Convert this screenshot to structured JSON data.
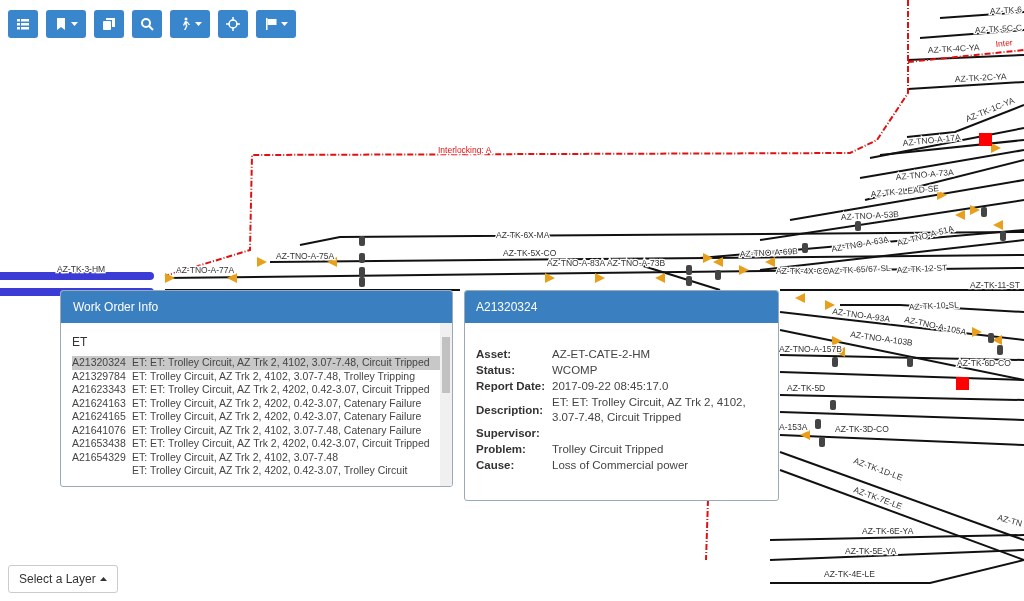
{
  "toolbar": {
    "buttons": [
      {
        "dropdown": false
      },
      {
        "dropdown": true
      },
      {
        "dropdown": false
      },
      {
        "dropdown": false
      },
      {
        "dropdown": true
      },
      {
        "dropdown": false
      },
      {
        "dropdown": true
      }
    ]
  },
  "map": {
    "labels": [
      {
        "text": "AZ-TK-6",
        "kind": "track"
      },
      {
        "text": "AZ-TK-5C-C",
        "kind": "track"
      },
      {
        "text": "Inter",
        "kind": "zone"
      },
      {
        "text": "AZ-TK-4C-YA",
        "kind": "track"
      },
      {
        "text": "AZ-TK-2C-YA",
        "kind": "track"
      },
      {
        "text": "AZ-TK-1C-YA",
        "kind": "track"
      },
      {
        "text": "Interlocking: A",
        "kind": "zone"
      },
      {
        "text": "AZ-TNO-A-17A",
        "kind": "track"
      },
      {
        "text": "AZ-TNO-A-73A",
        "kind": "track"
      },
      {
        "text": "AZ-TK-2LEAD-SE",
        "kind": "track"
      },
      {
        "text": "AZ-TNO-A-53B",
        "kind": "track"
      },
      {
        "text": "AZ-TK-6X-MA",
        "kind": "track"
      },
      {
        "text": "AZ-TNO-A-51A",
        "kind": "track"
      },
      {
        "text": "AZ-TNO-A-75A",
        "kind": "track"
      },
      {
        "text": "AZ-TK-5X-CO",
        "kind": "track"
      },
      {
        "text": "AZ-TNO-A-69B",
        "kind": "track"
      },
      {
        "text": "AZ-TNO-A-63A",
        "kind": "track"
      },
      {
        "text": "AZ-TK-3-HM",
        "kind": "track"
      },
      {
        "text": "AZ-TNO-A-77A",
        "kind": "track"
      },
      {
        "text": "AZ-TNO-A-83A",
        "kind": "track"
      },
      {
        "text": "AZ-TNO-A-73B",
        "kind": "track"
      },
      {
        "text": "AZ-TK-4X-CO",
        "kind": "track"
      },
      {
        "text": "AZ-TK-65/67-SL",
        "kind": "track"
      },
      {
        "text": "AZ-TK-12-ST",
        "kind": "track"
      },
      {
        "text": "AZ-TK-11-ST",
        "kind": "track"
      },
      {
        "text": "AZ-TK-10-SL",
        "kind": "track"
      },
      {
        "text": "AZ-TNO-A-93A",
        "kind": "track"
      },
      {
        "text": "AZ-TNO-A-105A",
        "kind": "track"
      },
      {
        "text": "AZ-TNO-A-103B",
        "kind": "track"
      },
      {
        "text": "AZ-TNO-A-157B",
        "kind": "track"
      },
      {
        "text": "AZ-TK-6D-CO",
        "kind": "track"
      },
      {
        "text": "AZ-TK-5D",
        "kind": "track"
      },
      {
        "text": "A-153A",
        "kind": "track"
      },
      {
        "text": "AZ-TK-3D-CO",
        "kind": "track"
      },
      {
        "text": "AZ-TK-1D-LE",
        "kind": "track"
      },
      {
        "text": "AZ-TK-7E-LE",
        "kind": "track"
      },
      {
        "text": "AZ-TN",
        "kind": "track"
      },
      {
        "text": "AZ-TK-6E-YA",
        "kind": "track"
      },
      {
        "text": "AZ-TK-5E-YA",
        "kind": "track"
      },
      {
        "text": "AZ-TK-4E-LE",
        "kind": "track"
      }
    ]
  },
  "work_order_panel": {
    "title": "Work Order Info",
    "filter": "ET",
    "items": [
      {
        "id": "A21320324",
        "text": "ET: ET: Trolley Circuit, AZ Trk 2, 4102, 3.07-7.48, Circuit Tripped",
        "selected": true
      },
      {
        "id": "A21329784",
        "text": "ET: Trolley Circuit, AZ Trk 2, 4102, 3.07-7.48, Trolley Tripping",
        "selected": false
      },
      {
        "id": "A21623343",
        "text": "ET: ET: Trolley Circuit, AZ Trk 2, 4202, 0.42-3.07, Circuit Tripped",
        "selected": false
      },
      {
        "id": "A21624163",
        "text": "ET: Trolley Circuit, AZ Trk 2, 4202, 0.42-3.07, Catenary Failure",
        "selected": false
      },
      {
        "id": "A21624165",
        "text": "ET: Trolley Circuit, AZ Trk 2, 4202, 0.42-3.07, Catenary Failure",
        "selected": false
      },
      {
        "id": "A21641076",
        "text": "ET: Trolley Circuit, AZ Trk 2, 4102, 3.07-7.48, Catenary Failure",
        "selected": false
      },
      {
        "id": "A21653438",
        "text": "ET: ET: Trolley Circuit, AZ Trk 2, 4202, 0.42-3.07, Circuit Tripped",
        "selected": false
      },
      {
        "id": "A21654329",
        "text": "ET: Trolley Circuit, AZ Trk 2, 4102, 3.07-7.48",
        "selected": false
      },
      {
        "text": "ET: Trolley Circuit, AZ Trk 2, 4202, 0.42-3.07, Trolley Circuit",
        "selected": false
      }
    ]
  },
  "detail_panel": {
    "title": "A21320324",
    "fields": [
      {
        "label": "Asset:",
        "value": "AZ-ET-CATE-2-HM"
      },
      {
        "label": "Status:",
        "value": "WCOMP"
      },
      {
        "label": "Report Date:",
        "value": "2017-09-22 08:45:17.0"
      },
      {
        "label": "Description:",
        "value": "ET: ET: Trolley Circuit, AZ Trk 2, 4102, 3.07-7.48, Circuit Tripped"
      },
      {
        "label": "Supervisor:"
      },
      {
        "label": "Problem:",
        "value": "Trolley Circuit Tripped"
      },
      {
        "label": "Cause:",
        "value": "Loss of Commercial power"
      }
    ]
  },
  "layer_button": {
    "label": "Select a Layer"
  }
}
